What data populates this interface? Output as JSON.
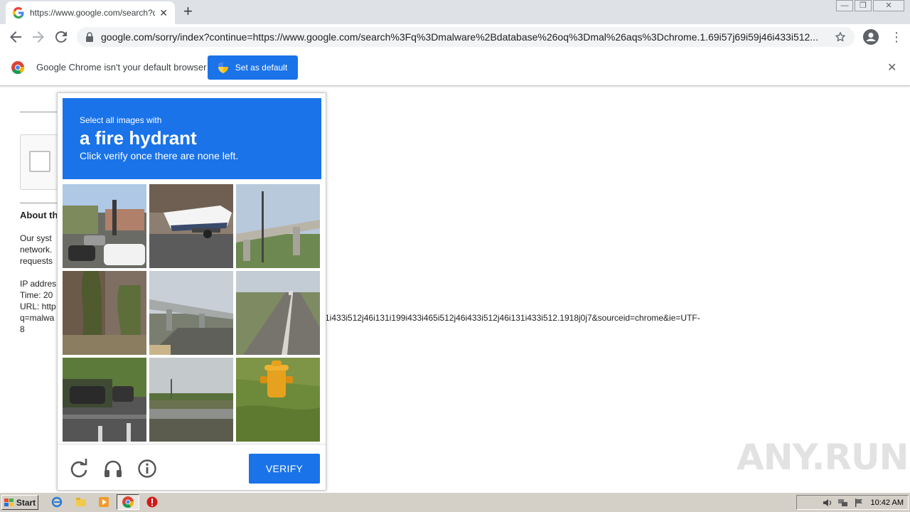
{
  "browser": {
    "tab_title": "https://www.google.com/search?q=",
    "tab_close": "✕",
    "new_tab": "+",
    "url": "google.com/sorry/index?continue=https://www.google.com/search%3Fq%3Dmalware%2Bdatabase%26oq%3Dmal%26aqs%3Dchrome.1.69i57j69i59j46i433i512...",
    "window_controls": [
      "—",
      "❐",
      "✕"
    ]
  },
  "infobar": {
    "message": "Google Chrome isn't your default browser",
    "button_label": "Set as default",
    "close": "✕"
  },
  "page": {
    "about_heading": "About th",
    "para1": [
      "Our syst",
      "network.",
      "requests"
    ],
    "ip_label": "IP addres",
    "time_label": "Time: 20",
    "url_label": "URL: http",
    "url_line2": "q=malwa",
    "url_tail": "1i433i512j46i131i199i433i465i512j46i433i512j46i131i433i512.1918j0j7&sourceid=chrome&ie=UTF-",
    "url_line3": "8"
  },
  "captcha": {
    "instruction_line1": "Select all images with",
    "target": "a fire hydrant",
    "instruction_line3": "Click verify once there are none left.",
    "verify_label": "VERIFY"
  },
  "watermark": "ANY.RUN",
  "taskbar": {
    "start_label": "Start",
    "clock": "10:42 AM"
  },
  "colors": {
    "accent_blue": "#1a73e8",
    "tabstrip": "#dee1e6",
    "taskbar": "#d4d0c8"
  }
}
